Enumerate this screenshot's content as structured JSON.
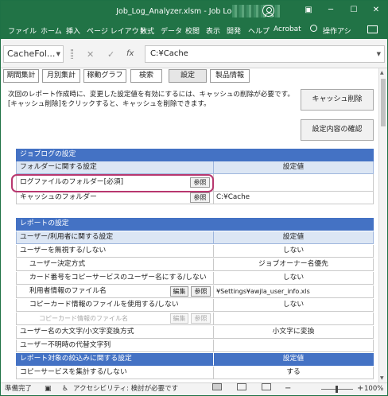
{
  "window": {
    "title": "Job_Log_Analyzer.xlsm - Job Log Analyzer",
    "min": "─",
    "max": "☐",
    "close": "✕",
    "ribbon_opts": "▣"
  },
  "ribbon": {
    "tabs": [
      "ファイル",
      "ホーム",
      "挿入",
      "ページ レイアウト",
      "数式",
      "データ",
      "校閲",
      "表示",
      "開発",
      "ヘルプ",
      "Acrobat"
    ],
    "tell_me": "操作アシ"
  },
  "formula_bar": {
    "name_box": "CacheFol...",
    "cancel": "✕",
    "enter": "✓",
    "fx": "fx",
    "value": "C:¥Cache"
  },
  "sheet_tabs": [
    "期間集計",
    "月別集計",
    "稼動グラフ",
    "検索",
    "設定",
    "製品情報"
  ],
  "info_text": [
    "次回のレポート作成時に、変更した設定値を有効にするには、キャッシュの削除が必要です。",
    "[キャッシュ削除]をクリックすると、キャッシュを削除できます。"
  ],
  "buttons": {
    "clear_cache": "キャッシュ削除",
    "check_settings": "設定内容の確認",
    "browse": "参照",
    "edit": "編集"
  },
  "job_log_section": {
    "title": "ジョブログの設定",
    "header": {
      "label": "フォルダーに関する設定",
      "value": "設定値"
    },
    "rows": [
      {
        "label": "ログファイルのフォルダー[必須]",
        "value": ""
      },
      {
        "label": "キャッシュのフォルダー",
        "value": "C:¥Cache"
      }
    ]
  },
  "report_section": {
    "title": "レポートの設定",
    "rows": [
      {
        "label": "ユーザー/利用者に関する設定",
        "value": "設定値"
      },
      {
        "label": "ユーザーを無視する/しない",
        "value": "しない"
      },
      {
        "label": "ユーザー決定方式",
        "value": "ジョブオーナー名優先"
      },
      {
        "label": "カード番号をコピーサービスのユーザー名にする/しない",
        "value": "しない"
      },
      {
        "label": "利用者情報のファイル名",
        "value": "¥Settings¥awjla_user_info.xls"
      },
      {
        "label": "コピーカード情報のファイルを使用する/しない",
        "value": "しない"
      },
      {
        "label": "コピーカード情報のファイル名",
        "value": ""
      },
      {
        "label": "ユーザー名の大文字/小文字変換方式",
        "value": "小文字に変換"
      },
      {
        "label": "ユーザー不明時の代替文字列",
        "value": ""
      },
      {
        "label": "レポート対象の絞込みに関する設定",
        "value": "設定値"
      },
      {
        "label": "コピーサービスを集計する/しない",
        "value": "する"
      }
    ]
  },
  "status": {
    "ready": "準備完了",
    "accessibility": "アクセシビリティ: 検討が必要です",
    "zoom_minus": "−",
    "zoom_plus": "+",
    "zoom": "100%"
  },
  "colors": {
    "excel_green": "#217346",
    "header_blue": "#4472c4",
    "subheader_blue": "#dce6f4",
    "highlight": "#b8376f"
  }
}
